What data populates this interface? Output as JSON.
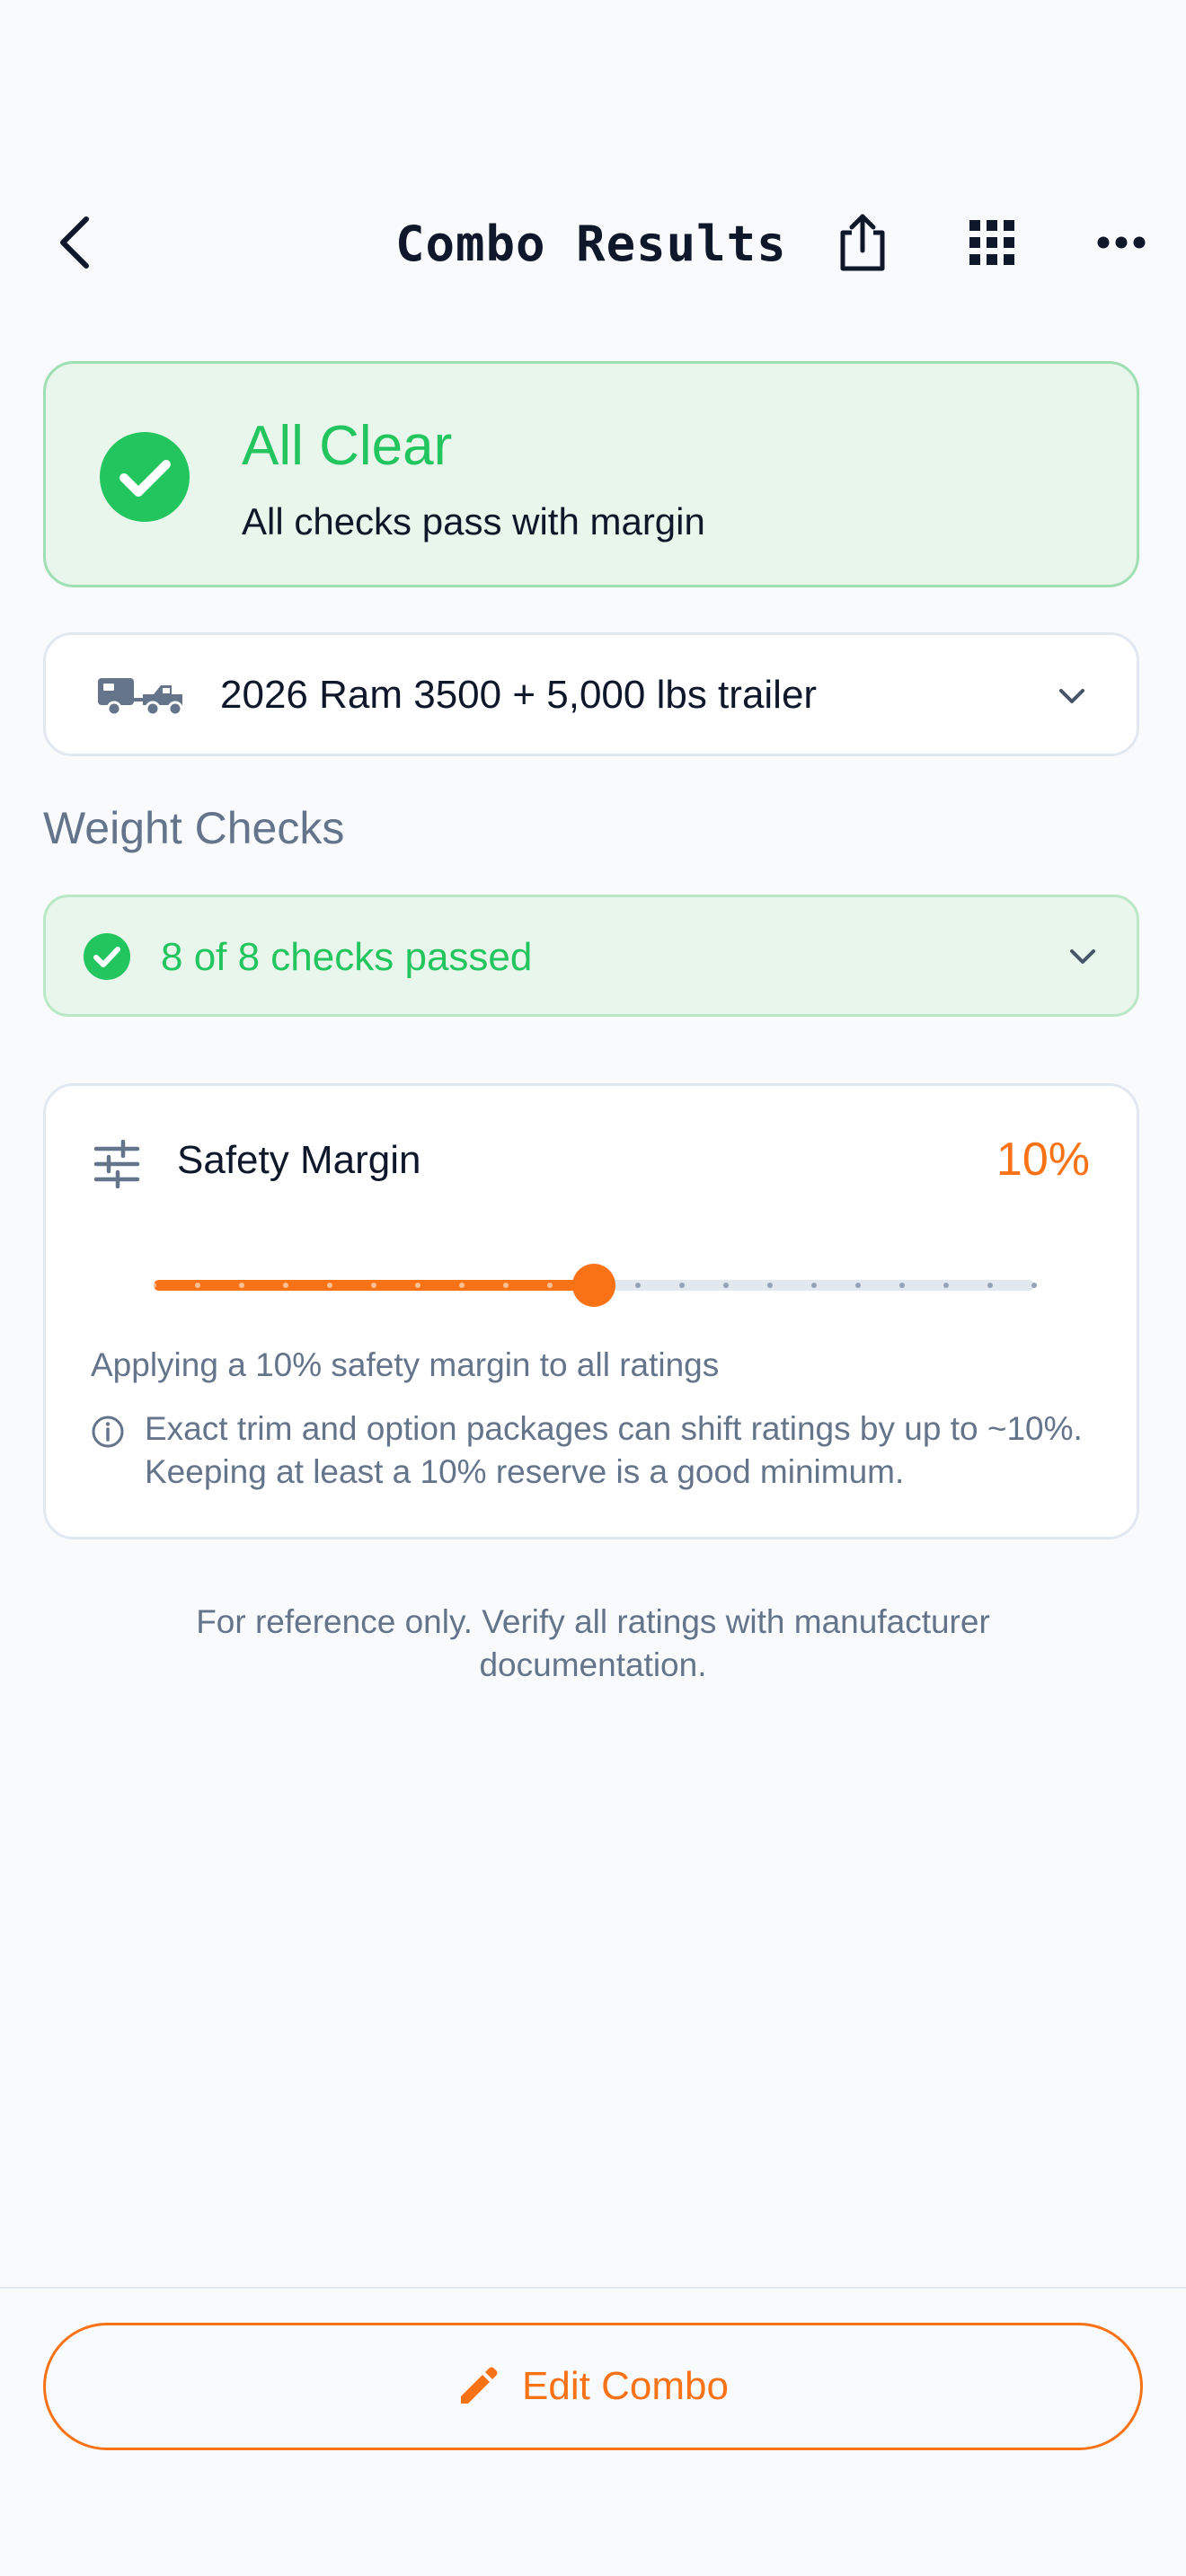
{
  "header": {
    "title": "Combo Results",
    "back_icon": "chevron-left-icon",
    "share_icon": "share-icon",
    "grid_icon": "grid-icon",
    "more_icon": "more-horizontal-icon"
  },
  "status": {
    "title": "All Clear",
    "subtitle": "All checks pass with margin",
    "icon": "check-circle-icon",
    "color": "#22c55e"
  },
  "combo": {
    "label": "2026 Ram 3500 + 5,000 lbs trailer",
    "icon": "truck-trailer-icon"
  },
  "weight_checks": {
    "heading": "Weight Checks",
    "summary": "8 of 8 checks passed",
    "passed": 8,
    "total": 8
  },
  "safety_margin": {
    "title": "Safety Margin",
    "value_label": "10%",
    "value": 10,
    "min": 0,
    "max": 20,
    "step": 1,
    "description": "Applying a 10% safety margin to all ratings",
    "note": "Exact trim and option packages can shift ratings by up to ~10%. Keeping at least a 10% reserve is a good minimum.",
    "accent": "#f97316"
  },
  "disclaimer": "For reference only. Verify all ratings with manufacturer documentation.",
  "footer": {
    "edit_label": "Edit Combo",
    "edit_icon": "pencil-icon"
  }
}
